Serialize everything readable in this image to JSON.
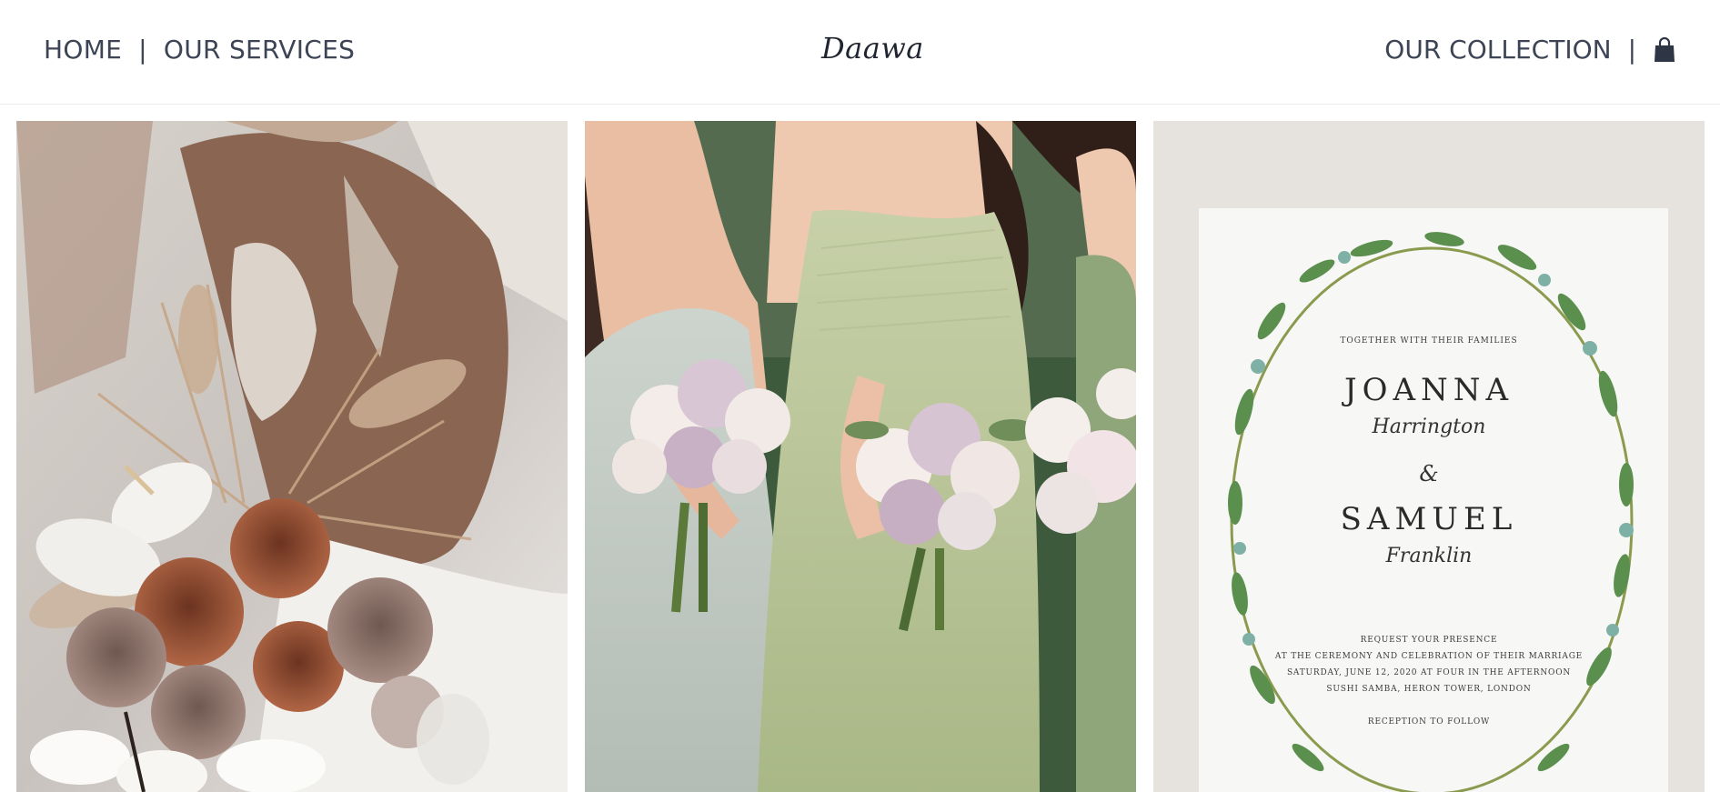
{
  "header": {
    "nav_left": [
      "HOME",
      "OUR SERVICES"
    ],
    "logo": "Daawa",
    "nav_right": "OUR COLLECTION",
    "cart_icon": "shopping-bag-icon"
  },
  "gallery": {
    "tiles": [
      {
        "name": "bridal-bouquet-image"
      },
      {
        "name": "bridesmaids-image"
      },
      {
        "name": "wedding-invitation-image"
      }
    ],
    "invitation": {
      "together": "TOGETHER WITH THEIR FAMILIES",
      "bride_first": "JOANNA",
      "bride_last": "Harrington",
      "amp": "&",
      "groom_first": "SAMUEL",
      "groom_last": "Franklin",
      "line1": "REQUEST YOUR PRESENCE",
      "line2": "AT THE CEREMONY AND CELEBRATION OF THEIR MARRIAGE",
      "line3": "SATURDAY, JUNE 12, 2020 AT FOUR IN THE AFTERNOON",
      "line4": "SUSHI SAMBA, HERON TOWER, LONDON",
      "line5": "RECEPTION TO FOLLOW"
    }
  },
  "colors": {
    "text": "#3c4455",
    "bouquet_rust": "#a0563a",
    "dress_sage": "#b9c59a",
    "leaf_green": "#5b8f4e"
  }
}
